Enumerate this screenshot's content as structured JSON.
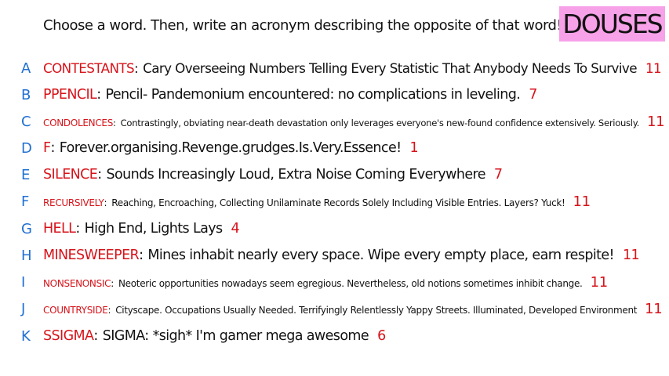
{
  "prompt": "Choose a word. Then, write an acronym describing the opposite of that word!",
  "title": "DOUSES",
  "colors": {
    "badge": "#f7a1e8",
    "letter": "#1f6fd1",
    "word": "#d7131a",
    "count": "#d7131a"
  },
  "entries": [
    {
      "letter": "A",
      "word": "CONTESTANTS",
      "acronym": "Cary Overseeing Numbers Telling Every Statistic That Anybody Needs To Survive",
      "count": "11"
    },
    {
      "letter": "B",
      "word": "PPENCIL",
      "acronym": "Pencil- Pandemonium encountered: no complications in leveling.",
      "count": "7"
    },
    {
      "letter": "C",
      "word": "CONDOLENCES",
      "acronym": "Contrastingly, obviating near-death devastation only leverages everyone's new-found confidence extensively. Seriously.",
      "count": "11"
    },
    {
      "letter": "D",
      "word": "F",
      "acronym": "Forever.organising.Revenge.grudges.Is.Very.Essence!",
      "count": "1"
    },
    {
      "letter": "E",
      "word": "SILENCE",
      "acronym": "Sounds Increasingly Loud, Extra Noise Coming Everywhere",
      "count": "7"
    },
    {
      "letter": "F",
      "word": "RECURSIVELY",
      "acronym": "Reaching, Encroaching, Collecting Unilaminate Records Solely Including Visible Entries. Layers? Yuck!",
      "count": "11"
    },
    {
      "letter": "G",
      "word": "HELL",
      "acronym": "High End, Lights Lays",
      "count": "4"
    },
    {
      "letter": "H",
      "word": "MINESWEEPER",
      "acronym": "Mines inhabit nearly every space. Wipe every empty place, earn respite!",
      "count": "11"
    },
    {
      "letter": "I",
      "word": "NONSENONSIC",
      "acronym": "Neoteric opportunities nowadays seem egregious. Nevertheless, old notions sometimes inhibit change.",
      "count": "11"
    },
    {
      "letter": "J",
      "word": "COUNTRYSIDE",
      "acronym": "Cityscape. Occupations Usually Needed. Terrifyingly Relentlessly Yappy Streets. Illuminated, Developed Environment",
      "count": "11"
    },
    {
      "letter": "K",
      "word": "SSIGMA",
      "acronym": "SIGMA: *sigh* I'm gamer mega awesome",
      "count": "6"
    }
  ]
}
